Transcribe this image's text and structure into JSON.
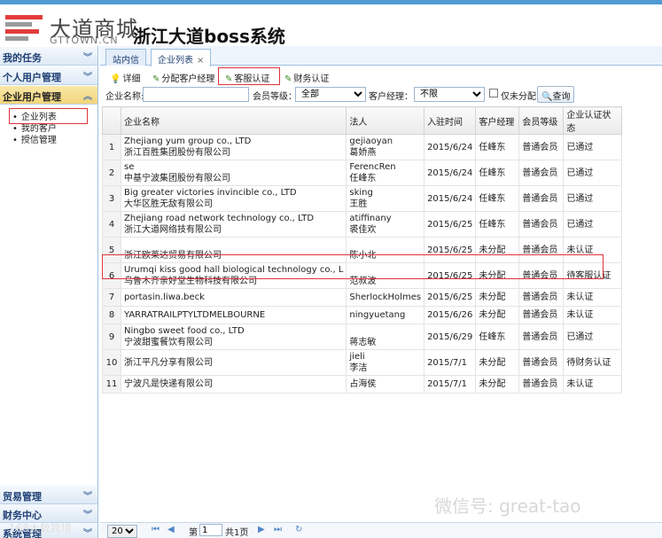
{
  "brand": {
    "logo_cn": "大道商城",
    "logo_en": "GTTOWN.CN",
    "system_title": "浙江大道boss系统"
  },
  "sidebar": {
    "sections": [
      {
        "label": "我的任务",
        "chevron": "«"
      },
      {
        "label": "个人用户管理",
        "chevron": "«"
      },
      {
        "label": "企业用户管理",
        "chevron": "»"
      }
    ],
    "items": [
      "企业列表",
      "我的客户",
      "授信管理"
    ],
    "bottom_sections": [
      {
        "label": "贸易管理",
        "chevron": "«"
      },
      {
        "label": "财务中心",
        "chevron": "«"
      },
      {
        "label": "系统管理",
        "chevron": "«"
      }
    ]
  },
  "tabs": [
    {
      "label": "站内信"
    },
    {
      "label": "企业列表",
      "close": "×"
    }
  ],
  "toolbar": {
    "detail": "详细",
    "assign": "分配客户经理",
    "cs_verify": "客服认证",
    "finance_verify": "财务认证"
  },
  "search": {
    "company_label": "企业名称:",
    "company_value": "",
    "level_label": "会员等级：",
    "level_value": "全部",
    "manager_label": "客户经理：",
    "manager_value": "不限",
    "unassigned_label": "仅未分配",
    "query_label": "查询"
  },
  "table": {
    "headers": [
      "企业名称",
      "法人",
      "入驻时间",
      "客户经理",
      "会员等级",
      "企业认证状态"
    ],
    "rows": [
      {
        "no": "1",
        "name": [
          "Zhejiang yum group co., LTD",
          "浙江百胜集团股份有限公司"
        ],
        "legal": [
          "gejiaoyan",
          "葛娇燕"
        ],
        "date": "2015/6/24",
        "manager": "任峰东",
        "level": "普通会员",
        "status": "已通过"
      },
      {
        "no": "2",
        "name": [
          "se",
          "中基宁波集团股份有限公司"
        ],
        "legal": [
          "FerencRen",
          "任峰东"
        ],
        "date": "2015/6/24",
        "manager": "任峰东",
        "level": "普通会员",
        "status": "已通过"
      },
      {
        "no": "3",
        "name": [
          "Big greater victories invincible co., LTD",
          "大华区胜无敌有限公司"
        ],
        "legal": [
          "sking",
          "王胜"
        ],
        "date": "2015/6/24",
        "manager": "任峰东",
        "level": "普通会员",
        "status": "已通过"
      },
      {
        "no": "4",
        "name": [
          "Zhejiang road network technology co., LTD",
          "浙江大道网络技有限公司"
        ],
        "legal": [
          "atiffinany",
          "裘佳欢"
        ],
        "date": "2015/6/25",
        "manager": "任峰东",
        "level": "普通会员",
        "status": "已通过"
      },
      {
        "no": "5",
        "name": [
          "",
          "浙江欧莱达贸易有限公司"
        ],
        "legal": [
          "",
          "陈小北"
        ],
        "date": "2015/6/25",
        "manager": "未分配",
        "level": "普通会员",
        "status": "未认证"
      },
      {
        "no": "6",
        "name": [
          "Urumqi kiss good hall biological technology co., L",
          "乌鲁木齐亲好堂生物科技有限公司"
        ],
        "legal": [
          "",
          "范叔波"
        ],
        "date": "2015/6/25",
        "manager": "未分配",
        "level": "普通会员",
        "status": "待客服认证"
      },
      {
        "no": "7",
        "name": [
          "portasin.liwa.beck"
        ],
        "legal": [
          "SherlockHolmes"
        ],
        "date": "2015/6/25",
        "manager": "未分配",
        "level": "普通会员",
        "status": "未认证"
      },
      {
        "no": "8",
        "name": [
          "YARRATRAILPTYLTDMELBOURNE"
        ],
        "legal": [
          "ningyuetang"
        ],
        "date": "2015/6/26",
        "manager": "未分配",
        "level": "普通会员",
        "status": "未认证"
      },
      {
        "no": "9",
        "name": [
          "Ningbo sweet food co., LTD",
          "宁波甜蜜餐饮有限公司"
        ],
        "legal": [
          "",
          "蒋志敏"
        ],
        "date": "2015/6/29",
        "manager": "任峰东",
        "level": "普通会员",
        "status": "已通过"
      },
      {
        "no": "10",
        "name": [
          "浙江平凡分享有限公司"
        ],
        "legal": [
          "jieli",
          "李洁"
        ],
        "date": "2015/7/1",
        "manager": "未分配",
        "level": "普通会员",
        "status": "待财务认证"
      },
      {
        "no": "11",
        "name": [
          "宁波凡是快递有限公司"
        ],
        "legal": [
          "占海侯"
        ],
        "date": "2015/7/1",
        "manager": "未分配",
        "level": "普通会员",
        "status": "未认证"
      }
    ]
  },
  "pager": {
    "page_size": "20",
    "page_prefix": "第",
    "page_value": "1",
    "page_total": "共1页"
  },
  "watermark": {
    "wechat": "微信号: great-tao",
    "corner": "168大数跨境"
  }
}
